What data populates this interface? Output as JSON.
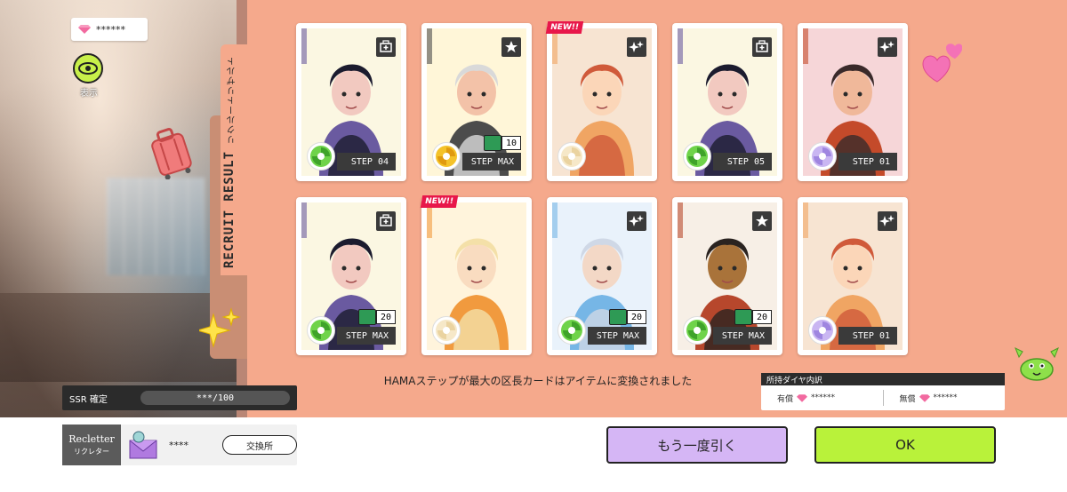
{
  "header": {
    "gem_count": "******",
    "display_toggle_label": "表示"
  },
  "panel": {
    "title_en": "RECRUIT RESULT",
    "title_ja": "リクルートリザルト"
  },
  "cards": [
    {
      "step": "STEP 04",
      "new": false,
      "level": null,
      "type_icon": "medical-icon",
      "attr": "green",
      "palette": [
        "#fbf7e2",
        "#6a5aa0",
        "#1b1b2e",
        "#f2c9c0"
      ]
    },
    {
      "step": "STEP MAX",
      "new": false,
      "level": "10",
      "type_icon": "star-icon",
      "attr": "yellow",
      "palette": [
        "#fff6d8",
        "#4c4c4c",
        "#d9d9d9",
        "#f3c2a8"
      ]
    },
    {
      "step": "",
      "new": true,
      "new_label": "NEW!!",
      "level": null,
      "type_icon": "sparkle-icon",
      "attr": "cream",
      "palette": [
        "#f7e4d2",
        "#f0a563",
        "#d05a3a",
        "#fbd6b8"
      ]
    },
    {
      "step": "STEP 05",
      "new": false,
      "level": null,
      "type_icon": "medical-icon",
      "attr": "green",
      "palette": [
        "#fbf7e2",
        "#6a5aa0",
        "#1b1b2e",
        "#f2c9c0"
      ]
    },
    {
      "step": "STEP 01",
      "new": false,
      "level": null,
      "type_icon": "sparkle-icon",
      "attr": "lavender",
      "palette": [
        "#f6d6d8",
        "#c44a2a",
        "#3a2a2a",
        "#f0b89a"
      ]
    },
    {
      "step": "STEP MAX",
      "new": false,
      "level": "20",
      "type_icon": "medical-icon",
      "attr": "green",
      "palette": [
        "#fbf7e2",
        "#6a5aa0",
        "#1b1b2e",
        "#f2c9c0"
      ]
    },
    {
      "step": "",
      "new": true,
      "new_label": "NEW!!",
      "level": null,
      "type_icon": null,
      "attr": "cream",
      "palette": [
        "#fff4dc",
        "#f19a3e",
        "#f4e0a8",
        "#f9dcc0"
      ]
    },
    {
      "step": "STEP MAX",
      "new": false,
      "level": "20",
      "type_icon": "sparkle-icon",
      "attr": "green",
      "palette": [
        "#e9f2fb",
        "#76b6e6",
        "#cfd8e6",
        "#f3d8c6"
      ]
    },
    {
      "step": "STEP MAX",
      "new": false,
      "level": "20",
      "type_icon": "star-icon",
      "attr": "green",
      "palette": [
        "#f7efe6",
        "#b7472c",
        "#2a2320",
        "#a9733a"
      ]
    },
    {
      "step": "STEP 01",
      "new": false,
      "level": null,
      "type_icon": "sparkle-icon",
      "attr": "lavender",
      "palette": [
        "#f7e4d2",
        "#f0a563",
        "#d05a3a",
        "#fbd6b8"
      ]
    }
  ],
  "notice": "HAMAステップが最大の区長カードはアイテムに変換されました",
  "owned": {
    "title": "所持ダイヤ内訳",
    "paid_label": "有償",
    "paid_value": "******",
    "free_label": "無償",
    "free_value": "******"
  },
  "ssr": {
    "label": "SSR 確定",
    "value": "***/100"
  },
  "recletter": {
    "label_en": "Recletter",
    "label_ja": "リクレター",
    "count": "****",
    "exchange_label": "交換所"
  },
  "buttons": {
    "again": "もう一度引く",
    "ok": "OK"
  },
  "colors": {
    "panel": "#f5a98c",
    "again_button": "#d5b6f5",
    "ok_button": "#b9f23a",
    "new_badge": "#e8174a",
    "gem": "#f26aa0"
  }
}
